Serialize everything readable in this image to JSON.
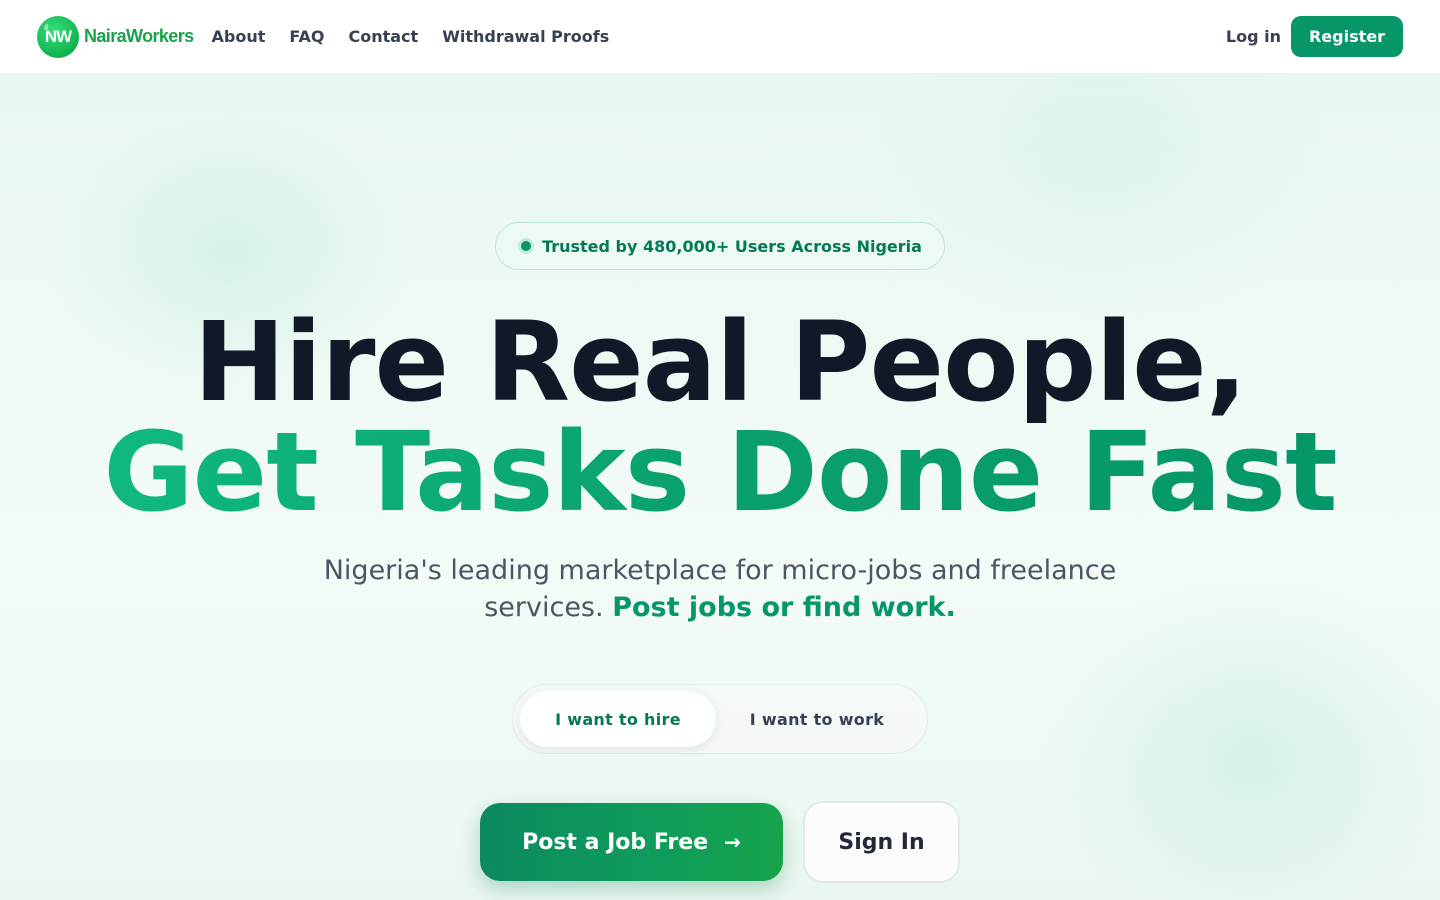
{
  "brand": {
    "badge_text": "NW",
    "name": "NairaWorkers",
    "color": "#16a34a"
  },
  "nav": {
    "items": [
      {
        "label": "About"
      },
      {
        "label": "FAQ"
      },
      {
        "label": "Contact"
      },
      {
        "label": "Withdrawal Proofs"
      }
    ],
    "login_label": "Log in",
    "register_label": "Register"
  },
  "hero": {
    "trust_badge": "Trusted by 480,000+ Users Across Nigeria",
    "headline_line1": "Hire Real People,",
    "headline_line2": "Get Tasks Done Fast",
    "subtitle_plain": "Nigeria's leading marketplace for micro-jobs and freelance services.",
    "subtitle_accent": "Post jobs or find work.",
    "toggle": {
      "options": [
        {
          "label": "I want to hire",
          "selected": true
        },
        {
          "label": "I want to work",
          "selected": false
        }
      ]
    },
    "primary_cta": "Post a Job Free",
    "primary_cta_icon": "arrow-right-icon",
    "secondary_cta": "Sign In"
  },
  "colors": {
    "accent": "#079669",
    "accent_light": "#10b981",
    "headline": "#111827",
    "text_muted": "#4b5563"
  }
}
